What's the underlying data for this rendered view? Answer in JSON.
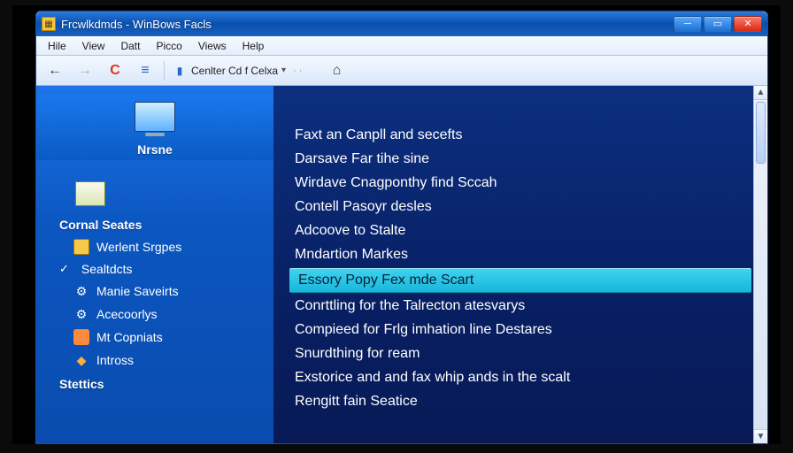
{
  "window": {
    "title": "Frcwlkdmds - WinBows Facls"
  },
  "menu": {
    "items": [
      "Hile",
      "View",
      "Datt",
      "Picco",
      "Views",
      "Help"
    ]
  },
  "toolbar": {
    "combo_label": "Cenlter Cd f Celxa",
    "back_icon": "←",
    "forward_icon": "→",
    "refresh_icon": "C",
    "list_icon": "≡",
    "separator_icon": "|",
    "folder_icon": "▮",
    "home_icon": "⌂"
  },
  "sidebar": {
    "top_label": "Nrsne",
    "heading1": "Cornal Seates",
    "items": [
      {
        "label": "Werlent Srgpes",
        "icon": "folder"
      },
      {
        "label": "Sealtdcts",
        "icon": "",
        "level0": true,
        "checked": true
      },
      {
        "label": "Manie Saveirts",
        "icon": "gear"
      },
      {
        "label": "Acecoorlys",
        "icon": "gear"
      },
      {
        "label": "Mt Copniats",
        "icon": "app"
      },
      {
        "label": "Intross",
        "icon": "shield"
      }
    ],
    "heading2": "Stettics"
  },
  "main": {
    "items": [
      {
        "label": "Faxt an Canpll and secefts",
        "selected": false
      },
      {
        "label": "Darsave Far tihe sine",
        "selected": false
      },
      {
        "label": "Wirdave Cnagponthy find Sccah",
        "selected": false
      },
      {
        "label": "Contell Pasoyr desles",
        "selected": false
      },
      {
        "label": "Adcoove to Stalte",
        "selected": false
      },
      {
        "label": "Mndartion Markes",
        "selected": false
      },
      {
        "label": "Essory Popy Fex mde Scart",
        "selected": true
      },
      {
        "label": "Conrttling for the Talrecton atesvarys",
        "selected": false
      },
      {
        "label": "Compieed for Frlg imhation line Destares",
        "selected": false
      },
      {
        "label": "Snurdthing for ream",
        "selected": false
      },
      {
        "label": "Exstorice and and fax whip ands in the scalt",
        "selected": false
      },
      {
        "label": "Rengitt fain Seatice",
        "selected": false
      }
    ]
  },
  "icons": {
    "folder_color": "#f7c94a",
    "gear_color": "#e8f0ff",
    "shield_color": "#ffb03a"
  }
}
